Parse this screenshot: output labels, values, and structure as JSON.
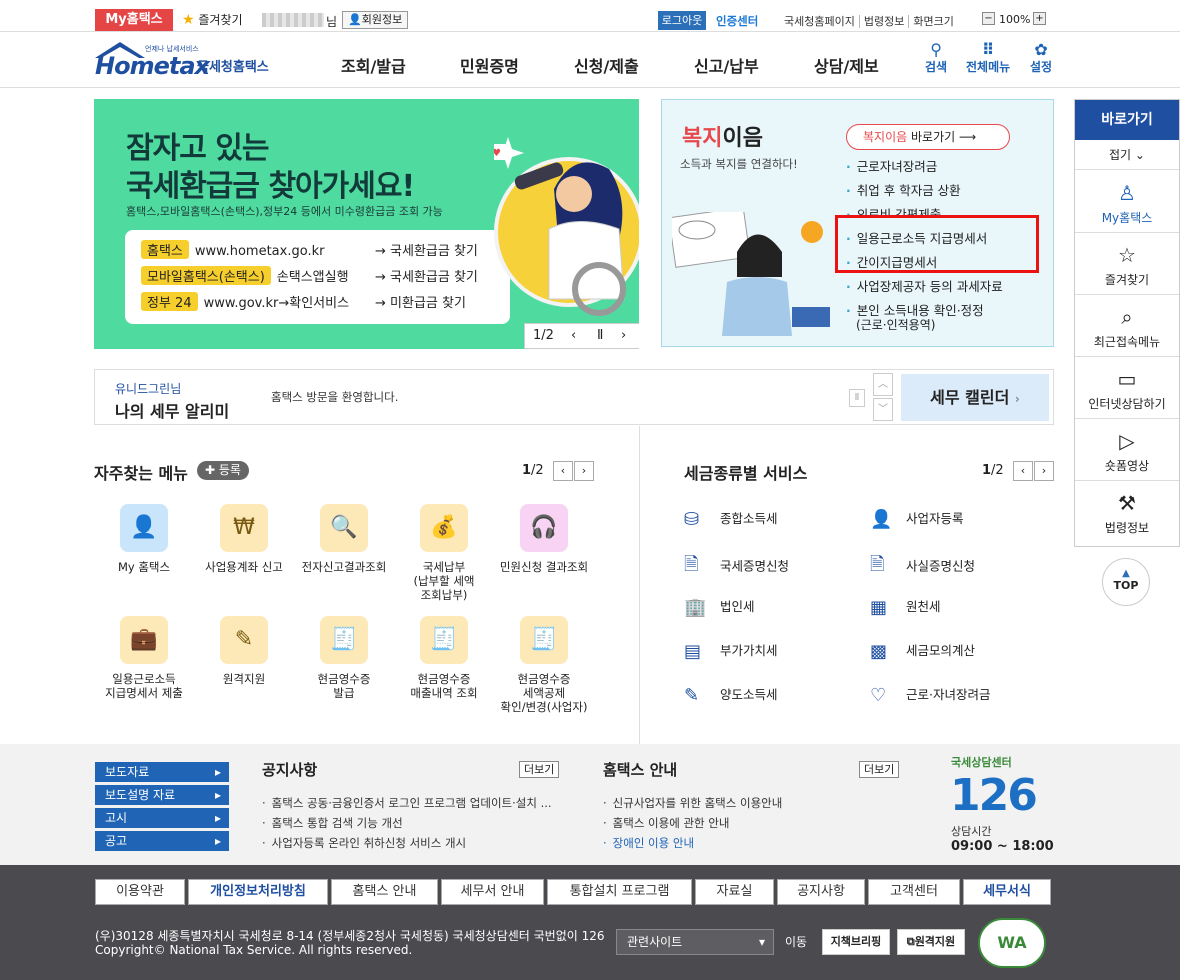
{
  "util": {
    "my_hometax": "My홈택스",
    "favorites": "즐겨찾기",
    "name_suffix": "님",
    "member_info": "회원정보",
    "logout": "로그아웃",
    "cert_center": "인증센터",
    "links": [
      "국세청홈페이지",
      "법령정보",
      "화면크기"
    ],
    "zoom": "100%"
  },
  "header": {
    "logo": "Hometax",
    "logo_tag": "언제나 납세서비스",
    "logo_sub": "국세청홈택스",
    "nav": [
      "조회/발급",
      "민원증명",
      "신청/제출",
      "신고/납부",
      "상담/제보"
    ],
    "icons": [
      {
        "label": "검색",
        "icon": "search-icon"
      },
      {
        "label": "전체메뉴",
        "icon": "grid-icon"
      },
      {
        "label": "설정",
        "icon": "gear-icon"
      }
    ]
  },
  "banner": {
    "line1": "잠자고 있는",
    "line2": "국세환급금 찾아가세요!",
    "desc": "홈택스,모바일홈택스(손택스),정부24 등에서 미수령환급금 조회 가능",
    "rows": [
      {
        "tag": "홈택스",
        "text": "www.hometax.go.kr",
        "arrow": "→ 국세환급금 찾기"
      },
      {
        "tag": "모바일홈택스(손택스)",
        "text": "손택스앱실행",
        "arrow": "→ 국세환급금 찾기"
      },
      {
        "tag": "정부 24",
        "text": "www.gov.kr→확인서비스",
        "arrow": "→ 미환급금 찾기"
      }
    ],
    "pager": "1/2"
  },
  "welfare": {
    "title_red": "복지",
    "title_black": "이음",
    "subtitle": "소득과 복지를 연결하다!",
    "go_red": "복지이음",
    "go_black": " 바로가기",
    "items": [
      "근로자녀장려금",
      "취업 후 학자금 상환",
      "의료비 간편제출",
      "일용근로소득 지급명세서",
      "간이지급명세서",
      "사업장제공자 등의 과세자료",
      "본인 소득내용 확인·정정",
      "(근로·인적용역)"
    ]
  },
  "strip": {
    "name": "유니드그린님",
    "title": "나의 세무 알리미",
    "message": "홈택스 방문을 환영합니다.",
    "calendar": "세무 캘린더"
  },
  "frequent": {
    "title": "자주찾는 메뉴",
    "add": "등록",
    "pager_cur": "1",
    "pager_total": "/2",
    "items": [
      "My 홈택스",
      "사업용계좌 신고",
      "전자신고결과조회",
      "국세납부\n(납부할 세액\n조회납부)",
      "민원신청 결과조회",
      "일용근로소득\n지급명세서 제출",
      "원격지원",
      "현금영수증\n발급",
      "현금영수증\n매출내역 조회",
      "현금영수증\n세액공제\n확인/변경(사업자)"
    ]
  },
  "taxsvc": {
    "title": "세금종류별 서비스",
    "pager_cur": "1",
    "pager_total": "/2",
    "left": [
      "종합소득세",
      "국세증명신청",
      "법인세",
      "부가가치세",
      "양도소득세"
    ],
    "right": [
      "사업자등록",
      "사실증명신청",
      "원천세",
      "세금모의계산",
      "근로·자녀장려금"
    ]
  },
  "news": {
    "nav": [
      "보도자료",
      "보도설명 자료",
      "고시",
      "공고"
    ],
    "notice_title": "공지사항",
    "more": "더보기",
    "notices": [
      "홈택스 공동·금융인증서 로그인 프로그램 업데이트·설치 ...",
      "홈택스 통합 검색 기능 개선",
      "사업자등록 온라인 취하신청 서비스 개시"
    ],
    "guide_title": "홈택스 안내",
    "guides": [
      "신규사업자를 위한 홈택스 이용안내",
      "홈택스 이용에 관한 안내",
      "장애인 이용 안내"
    ],
    "center_label": "국세상담센터",
    "center_num": "126",
    "hours_label": "상담시간",
    "hours": "09:00 ~ 18:00"
  },
  "footer": {
    "links": [
      "이용약관",
      "개인정보처리방침",
      "홈택스 안내",
      "세무서 안내",
      "통합설치 프로그램",
      "자료실",
      "공지사항",
      "고객센터",
      "세무서식"
    ],
    "addr1": "(우)30128 세종특별자치시 국세청로 8-14 (정부세종2청사 국세청동) 국세청상담센터 국번없이 126",
    "addr2": "Copyright© National Tax Service. All rights reserved.",
    "related": "관련사이트",
    "go": "이동",
    "btn1": "지책브리핑",
    "btn2": "원격지원",
    "wa": "WA"
  },
  "quick": {
    "title": "바로가기",
    "fold": "접기",
    "items": [
      {
        "label": "My홈택스",
        "icon": "person-icon"
      },
      {
        "label": "즐겨찾기",
        "icon": "star-icon"
      },
      {
        "label": "최근접속메뉴",
        "icon": "recent-icon"
      },
      {
        "label": "인터넷상담하기",
        "icon": "monitor-icon"
      },
      {
        "label": "숏폼영상",
        "icon": "play-icon"
      },
      {
        "label": "법령정보",
        "icon": "gavel-icon"
      }
    ],
    "top": "TOP"
  }
}
